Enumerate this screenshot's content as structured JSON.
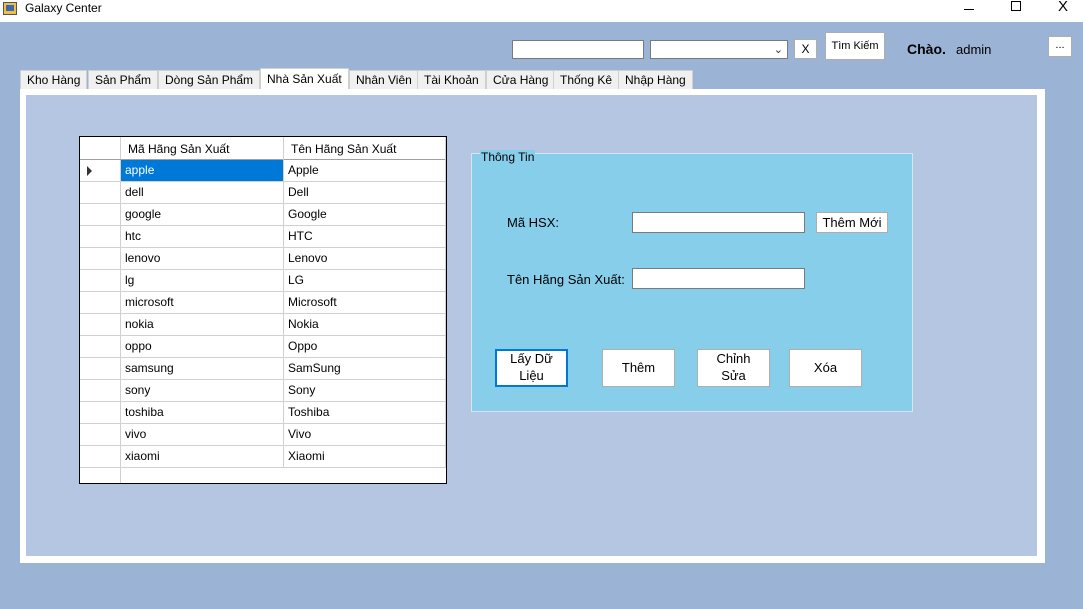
{
  "window": {
    "title": "Galaxy Center",
    "minimize_icon": "minimize-icon",
    "maximize_icon": "maximize-icon",
    "close_icon": "close-icon",
    "close_label": "X"
  },
  "toolbar": {
    "search_value": "",
    "combo_value": "",
    "combo_icon": "chevron-down-icon",
    "clear_label": "X",
    "find_label": "Tìm Kiếm",
    "greeting": "Chào.",
    "username": "admin",
    "more_label": "..."
  },
  "tabs": [
    {
      "label": "Kho Hàng",
      "active": false
    },
    {
      "label": "Sản Phẩm",
      "active": false
    },
    {
      "label": "Dòng Sản Phẩm",
      "active": false
    },
    {
      "label": "Nhà Sản Xuất",
      "active": true
    },
    {
      "label": "Nhân Viên",
      "active": false
    },
    {
      "label": "Tài Khoản",
      "active": false
    },
    {
      "label": "Cửa Hàng",
      "active": false
    },
    {
      "label": "Thống Kê",
      "active": false
    },
    {
      "label": "Nhập Hàng",
      "active": false
    }
  ],
  "grid": {
    "columns": [
      "Mã Hãng Sản Xuất",
      "Tên Hãng Sản Xuất"
    ],
    "selected_row": 0,
    "rows": [
      [
        "apple",
        "Apple"
      ],
      [
        "dell",
        "Dell"
      ],
      [
        "google",
        "Google"
      ],
      [
        "htc",
        "HTC"
      ],
      [
        "lenovo",
        "Lenovo"
      ],
      [
        "lg",
        "LG"
      ],
      [
        "microsoft",
        "Microsoft"
      ],
      [
        "nokia",
        "Nokia"
      ],
      [
        "oppo",
        "Oppo"
      ],
      [
        "samsung",
        "SamSung"
      ],
      [
        "sony",
        "Sony"
      ],
      [
        "toshiba",
        "Toshiba"
      ],
      [
        "vivo",
        "Vivo"
      ],
      [
        "xiaomi",
        "Xiaomi"
      ]
    ]
  },
  "info": {
    "legend": "Thông Tin",
    "code_label": "Mã HSX:",
    "code_value": "",
    "new_label": "Thêm Mới",
    "name_label": "Tên Hãng Sản Xuất:",
    "name_value": "",
    "load_line1": "Lấy Dữ",
    "load_line2": "Liệu",
    "add_label": "Thêm",
    "edit_line1": "Chỉnh",
    "edit_line2": "Sửa",
    "delete_label": "Xóa"
  },
  "colors": {
    "background": "#9bb3d4",
    "page": "#b4c6e1",
    "groupbox": "#87ceeb",
    "selection": "#0078d7"
  }
}
